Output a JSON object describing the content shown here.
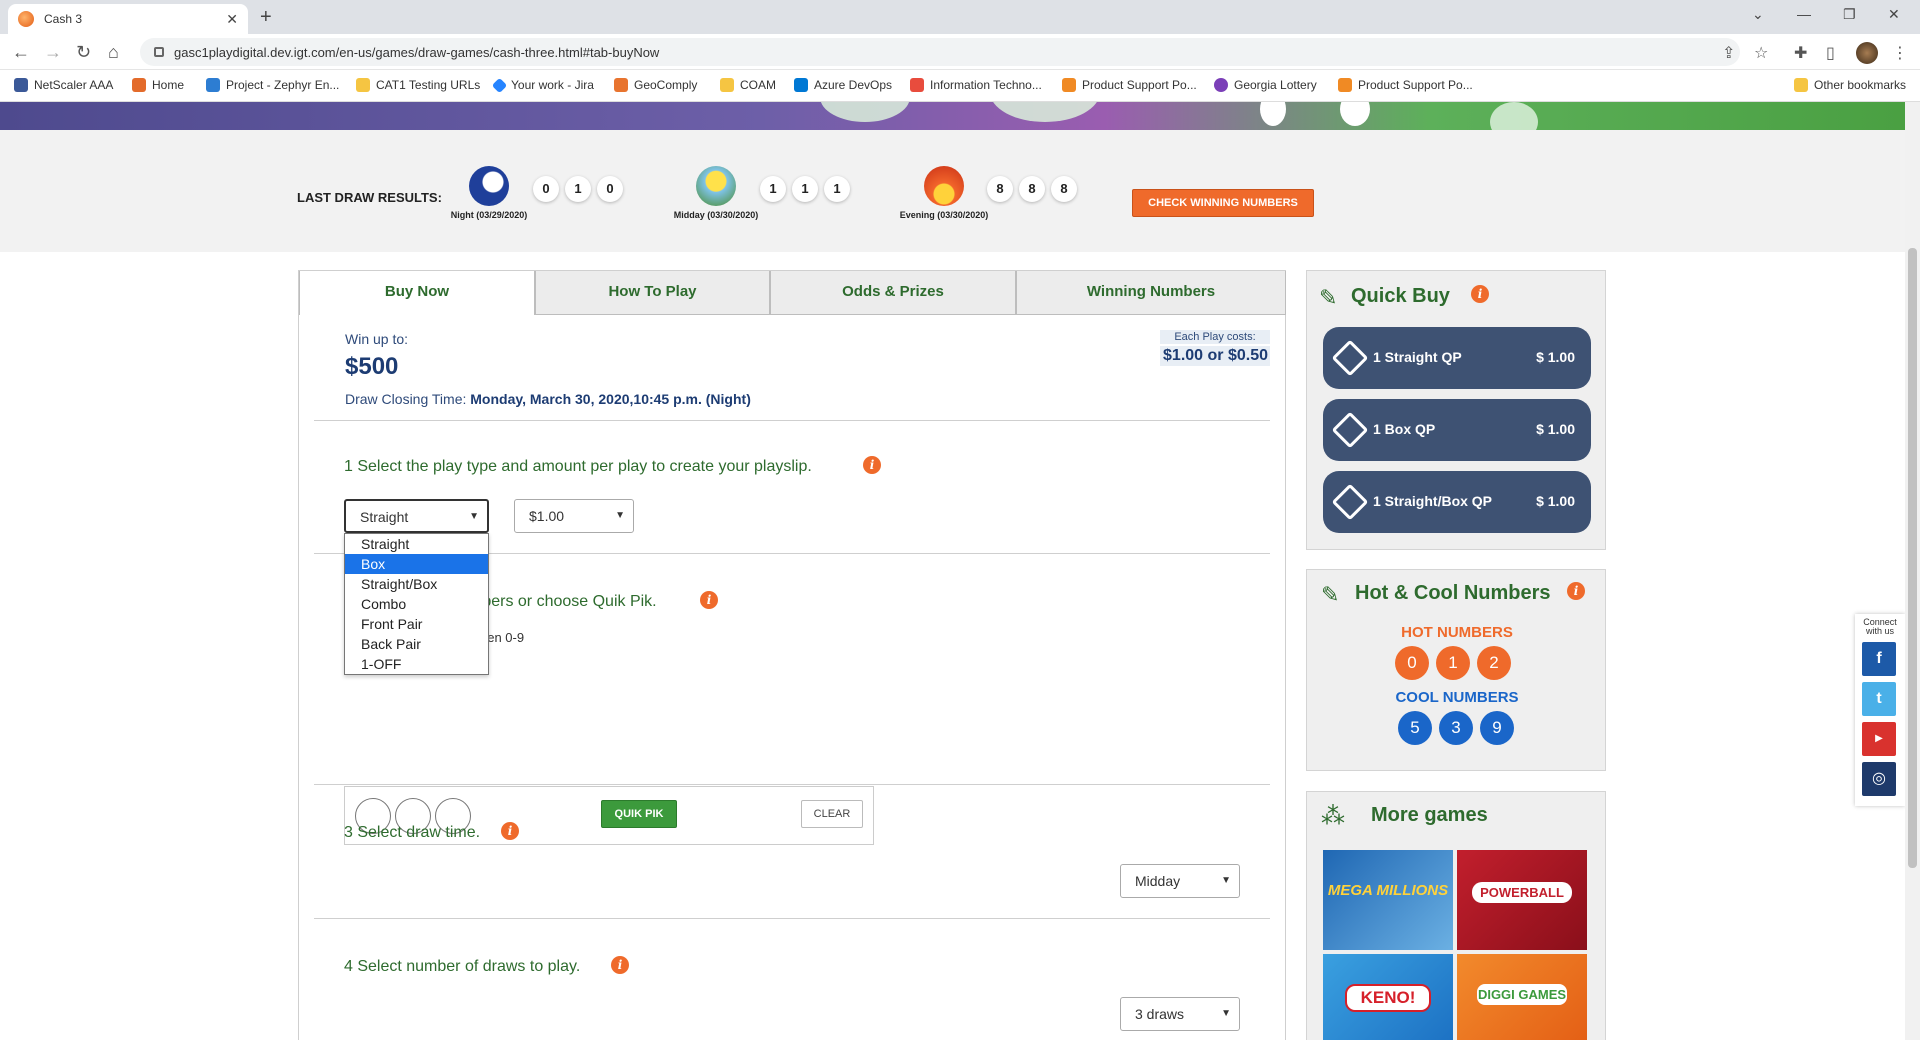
{
  "browser": {
    "tab_title": "Cash 3",
    "url": "gasc1playdigital.dev.igt.com/en-us/games/draw-games/cash-three.html#tab-buyNow",
    "bookmarks": [
      "NetScaler AAA",
      "Home",
      "Project - Zephyr En...",
      "CAT1 Testing URLs",
      "Your work - Jira",
      "GeoComply",
      "COAM",
      "Azure DevOps",
      "Information Techno...",
      "Product Support Po...",
      "Georgia Lottery",
      "Product Support Po..."
    ],
    "other_bookmarks": "Other bookmarks"
  },
  "last_draw": {
    "label": "LAST DRAW RESULTS:",
    "draws": [
      {
        "caption": "Night (03/29/2020)",
        "numbers": [
          "0",
          "1",
          "0"
        ],
        "icon": "moon-icon"
      },
      {
        "caption": "Midday (03/30/2020)",
        "numbers": [
          "1",
          "1",
          "1"
        ],
        "icon": "sun-icon"
      },
      {
        "caption": "Evening (03/30/2020)",
        "numbers": [
          "8",
          "8",
          "8"
        ],
        "icon": "sunset-icon"
      }
    ],
    "check_button": "CHECK WINNING NUMBERS"
  },
  "tabs": [
    "Buy Now",
    "How To Play",
    "Odds & Prizes",
    "Winning Numbers"
  ],
  "buy": {
    "win_up_to_label": "Win up to:",
    "win_amount": "$500",
    "closing_label": "Draw Closing Time:",
    "closing_value": "Monday, March 30, 2020,10:45 p.m. (Night)",
    "cost_label": "Each Play costs:",
    "cost_value": "$1.00 or $0.50"
  },
  "step1": {
    "text": "1 Select the play type and amount per play to create your playslip.",
    "play_type_value": "Straight",
    "amount_value": "$1.00",
    "options": [
      "Straight",
      "Box",
      "Straight/Box",
      "Combo",
      "Front Pair",
      "Back Pair",
      "1-OFF"
    ],
    "highlighted_option": "Box"
  },
  "step2": {
    "text_visible": "mbers or choose Quik Pik.",
    "sub_visible": "een 0-9",
    "quikpik_label": "QUIK PIK",
    "clear_label": "CLEAR"
  },
  "step3": {
    "text": "3 Select draw time.",
    "value": "Midday"
  },
  "step4": {
    "text": "4 Select number of draws to play.",
    "value": "3 draws"
  },
  "quick_buy": {
    "title": "Quick Buy",
    "buttons": [
      {
        "label": "1 Straight QP",
        "price": "$ 1.00"
      },
      {
        "label": "1 Box QP",
        "price": "$ 1.00"
      },
      {
        "label": "1 Straight/Box QP",
        "price": "$ 1.00"
      }
    ]
  },
  "hot_cool": {
    "title": "Hot & Cool Numbers",
    "hot_label": "HOT NUMBERS",
    "hot": [
      "0",
      "1",
      "2"
    ],
    "cool_label": "COOL NUMBERS",
    "cool": [
      "5",
      "3",
      "9"
    ]
  },
  "more_games": {
    "title": "More games",
    "games": [
      "MEGA MILLIONS",
      "POWERBALL",
      "KENO!",
      "DIGGI GAMES"
    ]
  },
  "connect": {
    "label_line1": "Connect",
    "label_line2": "with us"
  },
  "colors": {
    "green": "#2e6b2e",
    "orange": "#ef6a2b",
    "navy": "#3e5273",
    "hot": "#ef6a2b",
    "cool": "#1a66c9"
  }
}
